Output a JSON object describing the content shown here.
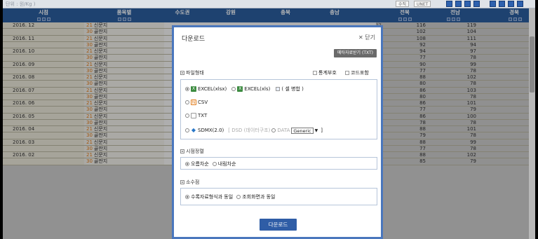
{
  "topbar": {
    "unit_label": "단위 : 원/Kg )",
    "btn_a": "수직",
    "btn_b": "UNET"
  },
  "table": {
    "columns": [
      "시점",
      "품목별",
      "수도권",
      "강원",
      "충북",
      "충남",
      "전북",
      "전남",
      "경북"
    ],
    "rows": [
      {
        "period": "2016. 12",
        "code": "21",
        "item": "신문지",
        "partial": "17",
        "jeonbuk": "116",
        "jeonnam": "119"
      },
      {
        "period": "",
        "code": "30",
        "item": "골판지",
        "partial": "02",
        "jeonbuk": "102",
        "jeonnam": "104"
      },
      {
        "period": "2016. 11",
        "code": "21",
        "item": "신문지",
        "partial": "12",
        "jeonbuk": "108",
        "jeonnam": "111"
      },
      {
        "period": "",
        "code": "30",
        "item": "골판지",
        "partial": "95",
        "jeonbuk": "92",
        "jeonnam": "94"
      },
      {
        "period": "2016. 10",
        "code": "21",
        "item": "신문지",
        "partial": "02",
        "jeonbuk": "94",
        "jeonnam": "97"
      },
      {
        "period": "",
        "code": "30",
        "item": "골판지",
        "partial": "81",
        "jeonbuk": "77",
        "jeonnam": "78"
      },
      {
        "period": "2016. 09",
        "code": "21",
        "item": "신문지",
        "partial": "06",
        "jeonbuk": "90",
        "jeonnam": "99"
      },
      {
        "period": "",
        "code": "30",
        "item": "골판지",
        "partial": "78",
        "jeonbuk": "77",
        "jeonnam": "78"
      },
      {
        "period": "2016. 08",
        "code": "21",
        "item": "신문지",
        "partial": "10",
        "jeonbuk": "88",
        "jeonnam": "102"
      },
      {
        "period": "",
        "code": "30",
        "item": "골판지",
        "partial": "79",
        "jeonbuk": "80",
        "jeonnam": "78"
      },
      {
        "period": "2016. 07",
        "code": "21",
        "item": "신문지",
        "partial": "08",
        "jeonbuk": "86",
        "jeonnam": "103"
      },
      {
        "period": "",
        "code": "30",
        "item": "골판지",
        "partial": "80",
        "jeonbuk": "80",
        "jeonnam": "78"
      },
      {
        "period": "2016. 06",
        "code": "21",
        "item": "신문지",
        "partial": "10",
        "jeonbuk": "86",
        "jeonnam": "101"
      },
      {
        "period": "",
        "code": "30",
        "item": "골판지",
        "partial": "79",
        "jeonbuk": "77",
        "jeonnam": "79"
      },
      {
        "period": "2016. 05",
        "code": "21",
        "item": "신문지",
        "partial": "06",
        "jeonbuk": "86",
        "jeonnam": "100"
      },
      {
        "period": "",
        "code": "30",
        "item": "골판지",
        "partial": "82",
        "jeonbuk": "78",
        "jeonnam": "78"
      },
      {
        "period": "2016. 04",
        "code": "21",
        "item": "신문지",
        "partial": "99",
        "jeonbuk": "88",
        "jeonnam": "101"
      },
      {
        "period": "",
        "code": "30",
        "item": "골판지",
        "partial": "84",
        "jeonbuk": "79",
        "jeonnam": "78"
      },
      {
        "period": "2016. 03",
        "code": "21",
        "item": "신문지",
        "partial": "04",
        "jeonbuk": "88",
        "jeonnam": "99"
      },
      {
        "period": "",
        "code": "30",
        "item": "골판지",
        "partial": "84",
        "jeonbuk": "77",
        "jeonnam": "78"
      },
      {
        "period": "2016. 02",
        "code": "21",
        "item": "신문지",
        "partial": "07",
        "jeonbuk": "88",
        "jeonnam": "102"
      },
      {
        "period": "",
        "code": "30",
        "item": "골판지",
        "partial": "88",
        "jeonbuk": "85",
        "jeonnam": "79"
      }
    ]
  },
  "dialog": {
    "title": "다운로드",
    "close_label": "✕ 닫기",
    "meta_button": "메타자료받기 (TXT)",
    "file_format": {
      "heading": "파일형태",
      "stat_symbol": "통계부호",
      "code_include": "코드포함",
      "options": {
        "xlsx": "EXCEL(xlsx)",
        "xls": "EXCEL(xls)",
        "merge": "( 셀 병합 )",
        "csv": "CSV",
        "txt": "TXT",
        "sdmx": "SDMX(2.0)",
        "dsd": "[ DSD (데이터구조)",
        "data": "DATA",
        "select_value": "Generic",
        "close_bracket": "]"
      }
    },
    "time_order": {
      "heading": "시점정렬",
      "asc": "오름차순",
      "desc": "내림차순"
    },
    "decimal": {
      "heading": "소수점",
      "same_as_source": "수록자료형식과 동일",
      "same_as_view": "조회화면과 동일"
    },
    "download_button": "다운로드"
  },
  "colors": {
    "header": "#2a5c9c",
    "accent": "#2f5da6",
    "dialog_border": "#4a77bd"
  }
}
